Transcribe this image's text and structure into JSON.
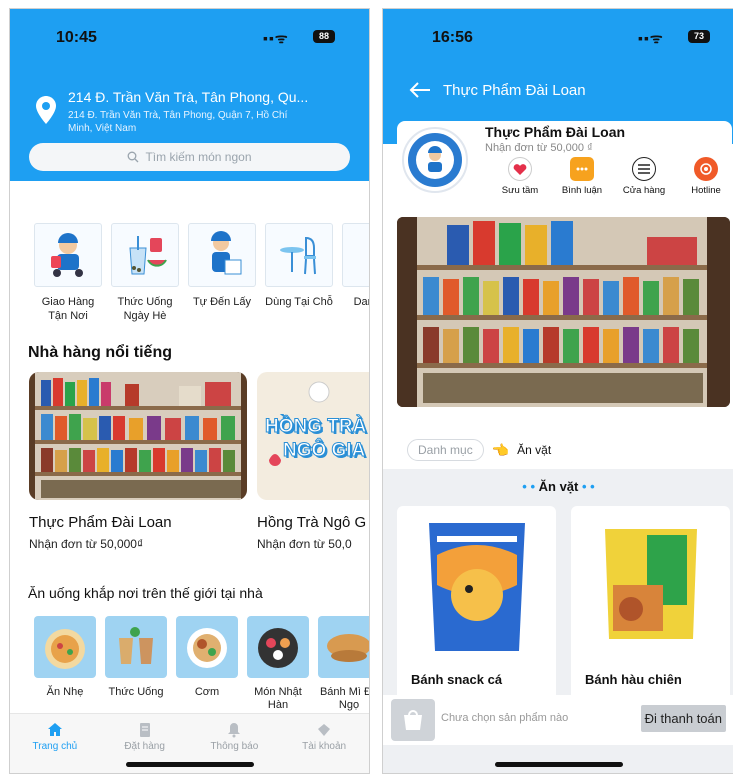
{
  "screen1": {
    "status": {
      "time": "10:45",
      "battery": "88"
    },
    "address": {
      "main": "214 Đ. Trần Văn Trà, Tân Phong, Qu...",
      "sub": "214 Đ. Trần Văn Trà, Tân Phong, Quận 7, Hồ Chí Minh, Việt Nam"
    },
    "search": {
      "placeholder": "Tìm kiếm món ngon"
    },
    "categories": [
      {
        "label": "Giao Hàng Tận Nơi"
      },
      {
        "label": "Thức Uống Ngày Hè"
      },
      {
        "label": "Tự Đến Lấy"
      },
      {
        "label": "Dùng Tại Chỗ"
      },
      {
        "label": "Danh Ưa"
      }
    ],
    "famous_title": "Nhà hàng nổi tiếng",
    "restaurants": [
      {
        "name": "Thực Phẩm Đài Loan",
        "sub": "Nhận đơn từ 50,000₫"
      },
      {
        "name": "Hồng Trà Ngô G",
        "sub": "Nhận đơn từ 50,0",
        "banner_text_1": "HỒNG TRÀ",
        "banner_text_2": "NGÔ GIA"
      }
    ],
    "world_title": "Ăn uống khắp nơi trên thế giới tại nhà",
    "food_categories": [
      {
        "label": "Ăn Nhẹ"
      },
      {
        "label": "Thức Uống"
      },
      {
        "label": "Cơm"
      },
      {
        "label": "Món Nhật Hàn"
      },
      {
        "label": "Bánh Mì Đồ Ngọ"
      }
    ],
    "tabs": [
      {
        "label": "Trang chủ",
        "icon": "home-icon"
      },
      {
        "label": "Đặt hàng",
        "icon": "order-icon"
      },
      {
        "label": "Thông báo",
        "icon": "bell-icon"
      },
      {
        "label": "Tài khoản",
        "icon": "account-icon"
      }
    ],
    "colors": {
      "brand": "#1e9ff2"
    }
  },
  "screen2": {
    "status": {
      "time": "16:56",
      "battery": "73"
    },
    "nav_title": "Thực Phẩm Đài Loan",
    "shop": {
      "name": "Thực Phẩm Đài Loan",
      "sub": "Nhận đơn từ 50,000 ₫",
      "actions": [
        {
          "label": "Sưu tầm",
          "icon": "heart-icon"
        },
        {
          "label": "Bình luận",
          "icon": "comment-icon"
        },
        {
          "label": "Cửa hàng",
          "icon": "list-icon"
        },
        {
          "label": "Hotline",
          "icon": "phone-icon"
        }
      ]
    },
    "filter": {
      "chip": "Danh mục",
      "selected": "Ăn vặt"
    },
    "section_title": "Ăn vặt",
    "products": [
      {
        "name": "Bánh snack cá"
      },
      {
        "name": "Bánh hàu chiên"
      }
    ],
    "cart": {
      "empty_text": "Chưa chọn sản phẩm nào",
      "checkout": "Đi thanh toán"
    }
  }
}
